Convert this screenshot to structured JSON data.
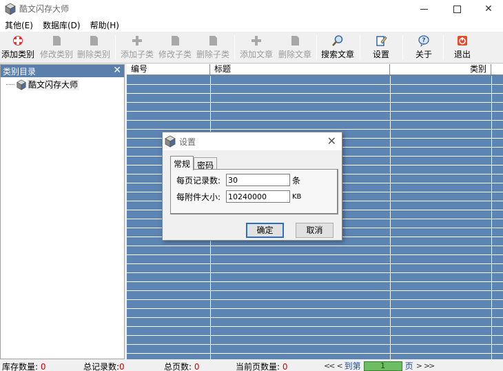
{
  "window": {
    "title": "酷文闪存大师"
  },
  "menu": [
    "其他(E)",
    "数据库(D)",
    "帮助(H)"
  ],
  "toolbar": {
    "add_category": "添加类别",
    "edit_category": "修改类别",
    "delete_category": "删除类别",
    "add_subcategory": "添加子类",
    "edit_subcategory": "修改子类",
    "delete_subcategory": "删除子类",
    "add_article": "添加文章",
    "delete_article": "删除文章",
    "search_article": "搜索文章",
    "settings": "设置",
    "about": "关于",
    "exit": "退出"
  },
  "sidebar": {
    "header": "类别目录",
    "close_glyph": "✕",
    "root_label": "酷文闪存大师"
  },
  "grid": {
    "columns": [
      "编号",
      "标题",
      "类别",
      ""
    ]
  },
  "status": {
    "stock_label": "库存数量:",
    "stock_value": "0",
    "total_label": "总记录数:",
    "total_value": "0",
    "pages_label": "总页数:",
    "pages_value": "0",
    "current_label": "当前页数量:",
    "current_value": "0",
    "prev_glyph": "<<",
    "prev1_glyph": "<",
    "goto_label": "到第",
    "page_value": "1",
    "page_unit": "页",
    "next1_glyph": ">",
    "next_glyph": ">>"
  },
  "dialog": {
    "title": "设置",
    "close_glyph": "✕",
    "tabs": [
      "常规",
      "密码"
    ],
    "records_label": "每页记录数:",
    "records_value": "30",
    "records_unit": "条",
    "attach_label": "每附件大小:",
    "attach_value": "10240000",
    "attach_unit": "KB",
    "ok": "确定",
    "cancel": "取消"
  },
  "colors": {
    "grid_bg": "#5c85b3",
    "sidebar_header": "#5a7fad",
    "status_value": "#d00000",
    "page_box": "#6dbe62",
    "ok_border": "#2b6fc9"
  }
}
